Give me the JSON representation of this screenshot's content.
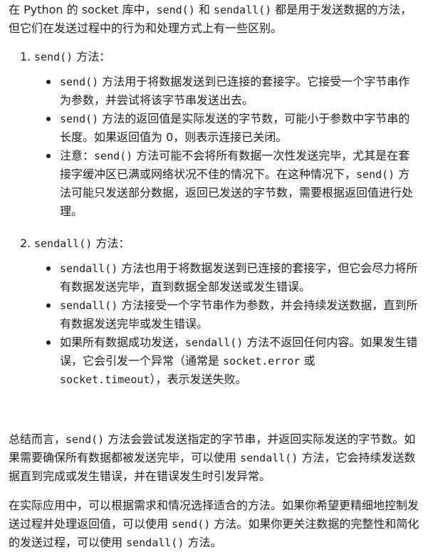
{
  "intro": {
    "t1": "在 Python 的 socket 库中，",
    "c1": "send()",
    "t2": " 和 ",
    "c2": "sendall()",
    "t3": " 都是用于发送数据的方法，但它们在发送过程中的行为和处理方式上有一些区别。"
  },
  "sections": [
    {
      "number": "1.",
      "code": "send()",
      "title": " 方法：",
      "bullets": [
        {
          "c1": "send()",
          "t1": " 方法用于将数据发送到已连接的套接字。它接受一个字节串作为参数，并尝试将该字节串发送出去。"
        },
        {
          "c1": "send()",
          "t1": " 方法的返回值是实际发送的字节数，可能小于参数中字节串的长度。如果返回值为 0，则表示连接已关闭。"
        },
        {
          "t0": "注意：",
          "c1": "send()",
          "t1": " 方法可能不会将所有数据一次性发送完毕，尤其是在套接字缓冲区已满或网络状况不佳的情况下。在这种情况下，",
          "c2": "send()",
          "t2": " 方法可能只发送部分数据，返回已发送的字节数，需要根据返回值进行处理。"
        }
      ]
    },
    {
      "number": "2.",
      "code": "sendall()",
      "title": " 方法：",
      "bullets": [
        {
          "c1": "sendall()",
          "t1": " 方法也用于将数据发送到已连接的套接字，但它会尽力将所有数据发送完毕，直到数据全部发送或发生错误。"
        },
        {
          "c1": "sendall()",
          "t1": " 方法接受一个字节串作为参数，并会持续发送数据，直到所有数据发送完毕或发生错误。"
        },
        {
          "t0": "如果所有数据成功发送，",
          "c1": "sendall()",
          "t1": " 方法不返回任何内容。如果发生错误，它会引发一个异常（通常是 ",
          "c2": "socket.error",
          "t2": " 或 ",
          "c3": "socket.timeout",
          "t3": "），表示发送失败。"
        }
      ]
    }
  ],
  "summary": {
    "t1": "总结而言，",
    "c1": "send()",
    "t2": " 方法会尝试发送指定的字节串，并返回实际发送的字节数。如果需要确保所有数据都被发送完毕，可以使用 ",
    "c2": "sendall()",
    "t3": " 方法，它会持续发送数据直到完成或发生错误，并在错误发生时引发异常。"
  },
  "closing": {
    "t1": "在实际应用中，可以根据需求和情况选择适合的方法。如果你希望更精细地控制发送过程并处理返回值，可以使用 ",
    "c1": "send()",
    "t2": " 方法。如果你更关注数据的完整性和简化的发送过程，可以使用 ",
    "c2": "sendall()",
    "t3": " 方法。"
  }
}
